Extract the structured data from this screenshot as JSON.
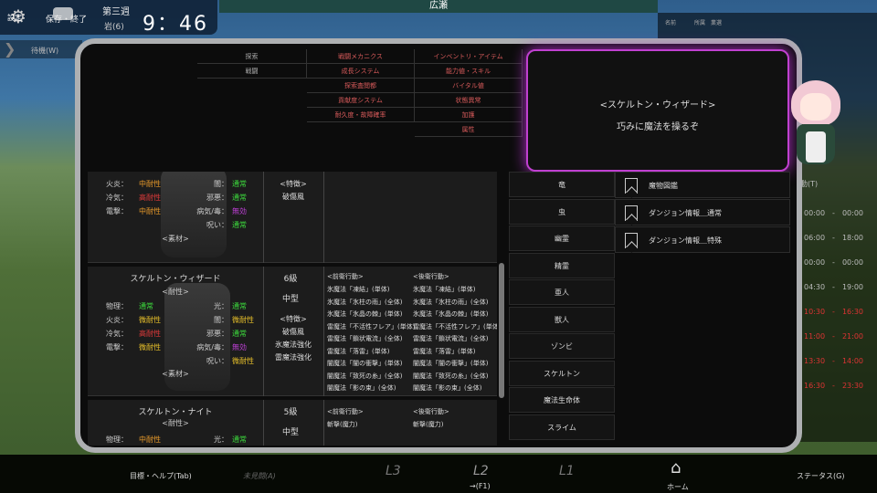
{
  "hud": {
    "gear_label": "設定",
    "save_label": "保存・終了",
    "week": "第三週",
    "day": "岩(6)",
    "clock": "9：46"
  },
  "topbar": {
    "label": "広瀬"
  },
  "nav": {
    "left_label": "待機(W)"
  },
  "right_panel": {
    "col1": "名前",
    "col2": "所属　業選",
    "header": "移動(T)",
    "rows": [
      {
        "time": "00:00　-　00:00",
        "red": false
      },
      {
        "time": "06:00　-　18:00",
        "red": false
      },
      {
        "time": "00:00　-　00:00",
        "red": false
      },
      {
        "time": "04:30　-　19:00",
        "red": false
      },
      {
        "time": "10:30　-　16:30",
        "red": true
      },
      {
        "time": "11:00　-　21:00",
        "red": true
      },
      {
        "time": "13:30　-　14:00",
        "red": true
      },
      {
        "time": "16:30　-　23:30",
        "red": true
      }
    ]
  },
  "menu": {
    "col1": [
      "探索",
      "戦闘"
    ],
    "col2": [
      "戦闘メカニクス",
      "成長システム",
      "探索査閲都",
      "貢献度システム",
      "耐久度・故障確率"
    ],
    "col3": [
      "インベントリ・アイテム",
      "能力値・スキル",
      "バイタル値",
      "状態異常",
      "加護",
      "属性"
    ]
  },
  "popup": {
    "title": "<スケルトン・ウィザード>",
    "line": "巧みに魔法を操るぞ"
  },
  "categories": [
    "竜",
    "虫",
    "幽霊",
    "精霊",
    "亜人",
    "獣人",
    "ゾンビ",
    "スケルトン",
    "魔法生命体",
    "スライム"
  ],
  "books": [
    "魔物図鑑",
    "ダンジョン情報＿通常",
    "ダンジョン情報＿特殊"
  ],
  "entry1": {
    "res": [
      {
        "k": "火炎：",
        "v": "中耐性",
        "c": "#e89a2a",
        "k2": "闇：",
        "v2": "通常",
        "c2": "#3ddc3d"
      },
      {
        "k": "冷気：",
        "v": "高耐性",
        "c": "#e03a3a",
        "k2": "邪悪：",
        "v2": "通常",
        "c2": "#3ddc3d"
      },
      {
        "k": "電撃：",
        "v": "中耐性",
        "c": "#e89a2a",
        "k2": "病気/毒：",
        "v2": "無効",
        "c2": "#c040d8"
      },
      {
        "k": "",
        "v": "",
        "c": "#ccc",
        "k2": "呪い：",
        "v2": "通常",
        "c2": "#3ddc3d"
      }
    ],
    "traits_label": "<特徴>",
    "traits": [
      "破傷風"
    ],
    "material": "<素材>"
  },
  "entry2": {
    "name": "スケルトン・ウィザード",
    "resist_label": "<耐性>",
    "level": "6級",
    "size": "中型",
    "res": [
      {
        "k": "物理：",
        "v": "通常",
        "c": "#3ddc3d",
        "k2": "光：",
        "v2": "通常",
        "c2": "#3ddc3d"
      },
      {
        "k": "火炎：",
        "v": "微耐性",
        "c": "#e8c02a",
        "k2": "闇：",
        "v2": "微耐性",
        "c2": "#e8c02a"
      },
      {
        "k": "冷気：",
        "v": "高耐性",
        "c": "#e03a3a",
        "k2": "邪悪：",
        "v2": "通常",
        "c2": "#3ddc3d"
      },
      {
        "k": "電撃：",
        "v": "微耐性",
        "c": "#e8c02a",
        "k2": "病気/毒：",
        "v2": "無効",
        "c2": "#c040d8"
      },
      {
        "k": "",
        "v": "",
        "c": "#ccc",
        "k2": "呪い：",
        "v2": "微耐性",
        "c2": "#e8c02a"
      }
    ],
    "traits_label": "<特徴>",
    "traits": [
      "破傷風",
      "氷魔法強化",
      "雷魔法強化"
    ],
    "material": "<素材>",
    "front_label": "<前衛行動>",
    "back_label": "<後衛行動>",
    "front": [
      "氷魔法「凍結」(単体)",
      "氷魔法「氷柱の雨」(全体)",
      "氷魔法「氷晶の棘」(単体)",
      "雷魔法「不活性フレア」(単体)",
      "雷魔法「鎖状電流」(全体)",
      "雷魔法「落雷」(単体)",
      "闇魔法「闇の衝撃」(単体)",
      "闇魔法「致死の糸」(全体)",
      "闇魔法「影の束」(全体)"
    ],
    "back": [
      "氷魔法「凍結」(単体)",
      "氷魔法「氷柱の雨」(全体)",
      "氷魔法「氷晶の棘」(単体)",
      "雷魔法「不活性フレア」(単体)",
      "雷魔法「鎖状電流」(全体)",
      "雷魔法「落雷」(単体)",
      "闇魔法「闇の衝撃」(単体)",
      "闇魔法「致死の糸」(全体)",
      "闇魔法「影の束」(全体)"
    ]
  },
  "entry3": {
    "name": "スケルトン・ナイト",
    "resist_label": "<耐性>",
    "level": "5級",
    "size": "中型",
    "res": [
      {
        "k": "物理：",
        "v": "中耐性",
        "c": "#e89a2a",
        "k2": "光：",
        "v2": "通常",
        "c2": "#3ddc3d"
      }
    ],
    "front_label": "<前衛行動>",
    "back_label": "<後衛行動>",
    "front": [
      "斬撃(魔力)"
    ],
    "back": [
      "斬撃(魔力)"
    ]
  },
  "bottom": {
    "help": "目標・ヘルプ(Tab)",
    "faded1": "未見闘(A)",
    "l3": "L3",
    "l2": "L2",
    "l1": "L1",
    "key_hint": "→(F1)",
    "home": "ホーム",
    "status": "ステータス(G)"
  }
}
